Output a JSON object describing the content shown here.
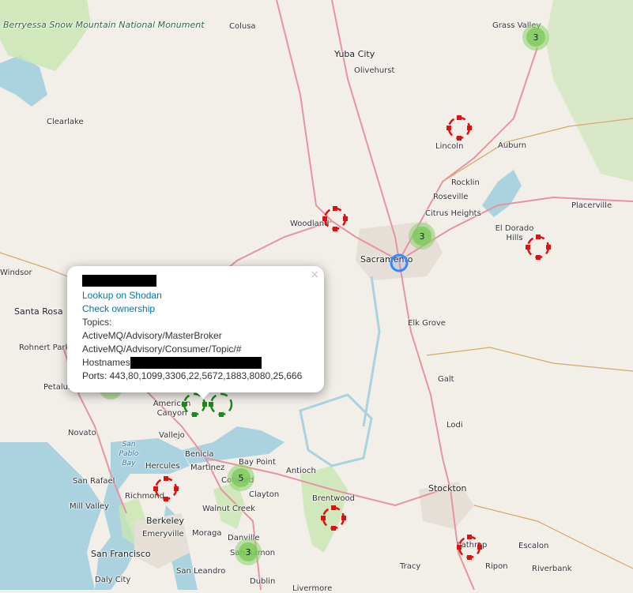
{
  "map": {
    "places": [
      {
        "key": "colusa",
        "label": "Colusa"
      },
      {
        "key": "yuba_city",
        "label": "Yuba City"
      },
      {
        "key": "olivehurst",
        "label": "Olivehurst"
      },
      {
        "key": "grass_valley",
        "label": "Grass Valley"
      },
      {
        "key": "clearlake",
        "label": "Clearlake"
      },
      {
        "key": "lincoln",
        "label": "Lincoln"
      },
      {
        "key": "auburn",
        "label": "Auburn"
      },
      {
        "key": "rocklin",
        "label": "Rocklin"
      },
      {
        "key": "roseville",
        "label": "Roseville"
      },
      {
        "key": "citrus_heights",
        "label": "Citrus Heights"
      },
      {
        "key": "placerville",
        "label": "Placerville"
      },
      {
        "key": "el_dorado_hills",
        "label": "El Dorado Hills"
      },
      {
        "key": "woodland",
        "label": "Woodland"
      },
      {
        "key": "sacramento",
        "label": "Sacramento"
      },
      {
        "key": "windsor",
        "label": "Windsor"
      },
      {
        "key": "santa_rosa",
        "label": "Santa Rosa"
      },
      {
        "key": "rohnert_park",
        "label": "Rohnert Park"
      },
      {
        "key": "petaluma",
        "label": "Petalum"
      },
      {
        "key": "elk_grove",
        "label": "Elk Grove"
      },
      {
        "key": "galt",
        "label": "Galt"
      },
      {
        "key": "lodi",
        "label": "Lodi"
      },
      {
        "key": "american_canyon",
        "label": "American Canyon"
      },
      {
        "key": "novato",
        "label": "Novato"
      },
      {
        "key": "vallejo",
        "label": "Vallejo"
      },
      {
        "key": "san_pablo_bay",
        "label": "San Pablo Bay"
      },
      {
        "key": "benicia",
        "label": "Benicia"
      },
      {
        "key": "hercules",
        "label": "Hercules"
      },
      {
        "key": "martinez",
        "label": "Martinez"
      },
      {
        "key": "bay_point",
        "label": "Bay Point"
      },
      {
        "key": "antioch",
        "label": "Antioch"
      },
      {
        "key": "concord",
        "label": "Concord"
      },
      {
        "key": "clayton",
        "label": "Clayton"
      },
      {
        "key": "san_rafael",
        "label": "San Rafael"
      },
      {
        "key": "richmond",
        "label": "Richmond"
      },
      {
        "key": "brentwood",
        "label": "Brentwood"
      },
      {
        "key": "stockton",
        "label": "Stockton"
      },
      {
        "key": "mill_valley",
        "label": "Mill Valley"
      },
      {
        "key": "walnut_creek",
        "label": "Walnut Creek"
      },
      {
        "key": "berkeley",
        "label": "Berkeley"
      },
      {
        "key": "emeryville",
        "label": "Emeryville"
      },
      {
        "key": "moraga",
        "label": "Moraga"
      },
      {
        "key": "danville",
        "label": "Danville"
      },
      {
        "key": "san_francisco",
        "label": "San Francisco"
      },
      {
        "key": "san_ramon",
        "label": "San Ramon"
      },
      {
        "key": "lathrop",
        "label": "Lathrop"
      },
      {
        "key": "escalon",
        "label": "Escalon"
      },
      {
        "key": "tracy",
        "label": "Tracy"
      },
      {
        "key": "ripon",
        "label": "Ripon"
      },
      {
        "key": "riverbank",
        "label": "Riverbank"
      },
      {
        "key": "daly_city",
        "label": "Daly City"
      },
      {
        "key": "san_leandro",
        "label": "San Leandro"
      },
      {
        "key": "dublin",
        "label": "Dublin"
      },
      {
        "key": "livermore",
        "label": "Livermore"
      },
      {
        "key": "berryessa",
        "label": "Berryessa Snow Mountain National Monument"
      }
    ],
    "clusters": [
      {
        "key": "grass_valley",
        "count": "3"
      },
      {
        "key": "sacramento",
        "count": "3"
      },
      {
        "key": "concord",
        "count": "5"
      },
      {
        "key": "san_ramon",
        "count": "3"
      }
    ],
    "colors": {
      "background": "#f2efe9",
      "water": "#aad3df",
      "park": "#c8e6b0",
      "highway": "#e892a2",
      "marker_red": "#e01010",
      "marker_green": "#1a8a1a",
      "cluster_green": "#8bd26e",
      "selected_blue": "#3388ff"
    }
  },
  "popup": {
    "lookup_link": "Lookup on Shodan",
    "ownership_link": "Check ownership",
    "topics_label": "Topics:",
    "topics": [
      "ActiveMQ/Advisory/MasterBroker",
      "ActiveMQ/Advisory/Consumer/Topic/#"
    ],
    "hostnames_label": "Hostnames",
    "ports_text": "Ports: 443,80,1099,3306,22,5672,1883,8080,25,666",
    "close_glyph": "×"
  }
}
